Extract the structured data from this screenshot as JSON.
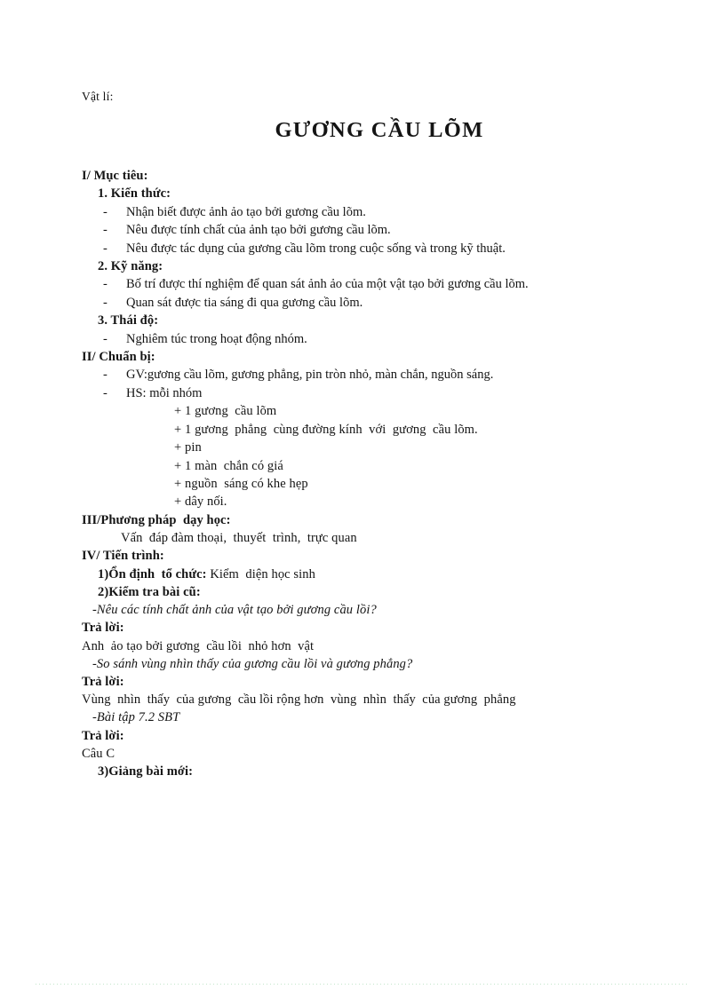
{
  "document": {
    "subject_label": "Vật lí:",
    "title": "GƯƠNG CẦU LÕM",
    "sections": {
      "objectives": {
        "heading": "I/ Mục tiêu:",
        "groups": [
          {
            "heading": "1. Kiến thức:",
            "items": [
              "Nhận biết được ảnh ảo tạo bởi gương  cầu lõm.",
              "Nêu được tính  chất của ảnh tạo bởi gương  cầu lõm.",
              "Nêu được tác dụng của gương  cầu lõm  trong  cuộc sống và trong kỹ thuật."
            ]
          },
          {
            "heading": "2. Kỹ năng:",
            "items": [
              "Bố trí được thí nghiệm  để quan sát ảnh ảo của một vật tạo bởi gương  cầu lõm.",
              "Quan sát được tia sáng đi qua gương  cầu lõm."
            ]
          },
          {
            "heading": "3. Thái độ:",
            "items": [
              "Nghiêm  túc trong hoạt động nhóm."
            ]
          }
        ]
      },
      "preparation": {
        "heading": "II/ Chuẩn bị:",
        "teacher_item": "GV:gương  cầu lõm, gương  phẳng, pin tròn nhỏ, màn chắn, nguồn  sáng.",
        "student_item": "HS: mỗi nhóm",
        "student_subitems": [
          "+ 1 gương  cầu lõm",
          "+ 1 gương  phẳng  cùng đường kính  với  gương  cầu lõm.",
          "+ pin",
          "+ 1 màn  chắn có giá",
          "+ nguồn  sáng có khe hẹp",
          "+ dây nối."
        ]
      },
      "method": {
        "heading": "III/Phương pháp  dạy học:",
        "text": "Vấn  đáp đàm thoại,  thuyết  trình,  trực quan"
      },
      "procedure": {
        "heading": "IV/ Tiến trình:",
        "step1": {
          "label": "1)Ổn định  tổ chức:",
          "text": " Kiểm  diện học sinh"
        },
        "step2": {
          "label": "2)Kiểm tra bài cũ:",
          "qa": [
            {
              "question": "-Nêu các tính chất ảnh của vật tạo bởi gương cầu lồi?",
              "answer_label": "Trả lời:",
              "answer": "Anh  ảo tạo bởi gương  cầu lồi  nhỏ hơn  vật"
            },
            {
              "question": "-So sánh vùng nhìn thấy của gương cầu lồi và gương phẳng?",
              "answer_label": "Trả lời:",
              "answer": "Vùng  nhìn  thấy  của gương  cầu lồi rộng hơn  vùng  nhìn  thấy  của gương  phẳng"
            },
            {
              "question": "-Bài tập 7.2 SBT",
              "answer_label": "Trả lời:",
              "answer": "Câu C"
            }
          ]
        },
        "step3": {
          "label": "3)Giảng bài mới:"
        }
      }
    }
  }
}
